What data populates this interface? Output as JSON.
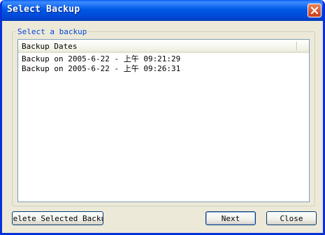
{
  "window": {
    "title": "Select Backup"
  },
  "group": {
    "label": "Select a backup"
  },
  "list": {
    "header": "Backup Dates",
    "rows": [
      "Backup on 2005-6-22 - 上午 09:21:29",
      "Backup on 2005-6-22 - 上午 09:26:31"
    ]
  },
  "buttons": {
    "delete": "Delete Selected Backup",
    "next": "Next",
    "close": "Close"
  },
  "icons": {
    "close": "close-x-icon"
  },
  "colors": {
    "titlebar": "#0058e6",
    "group_label": "#0046d5",
    "close_button": "#d8532c"
  }
}
